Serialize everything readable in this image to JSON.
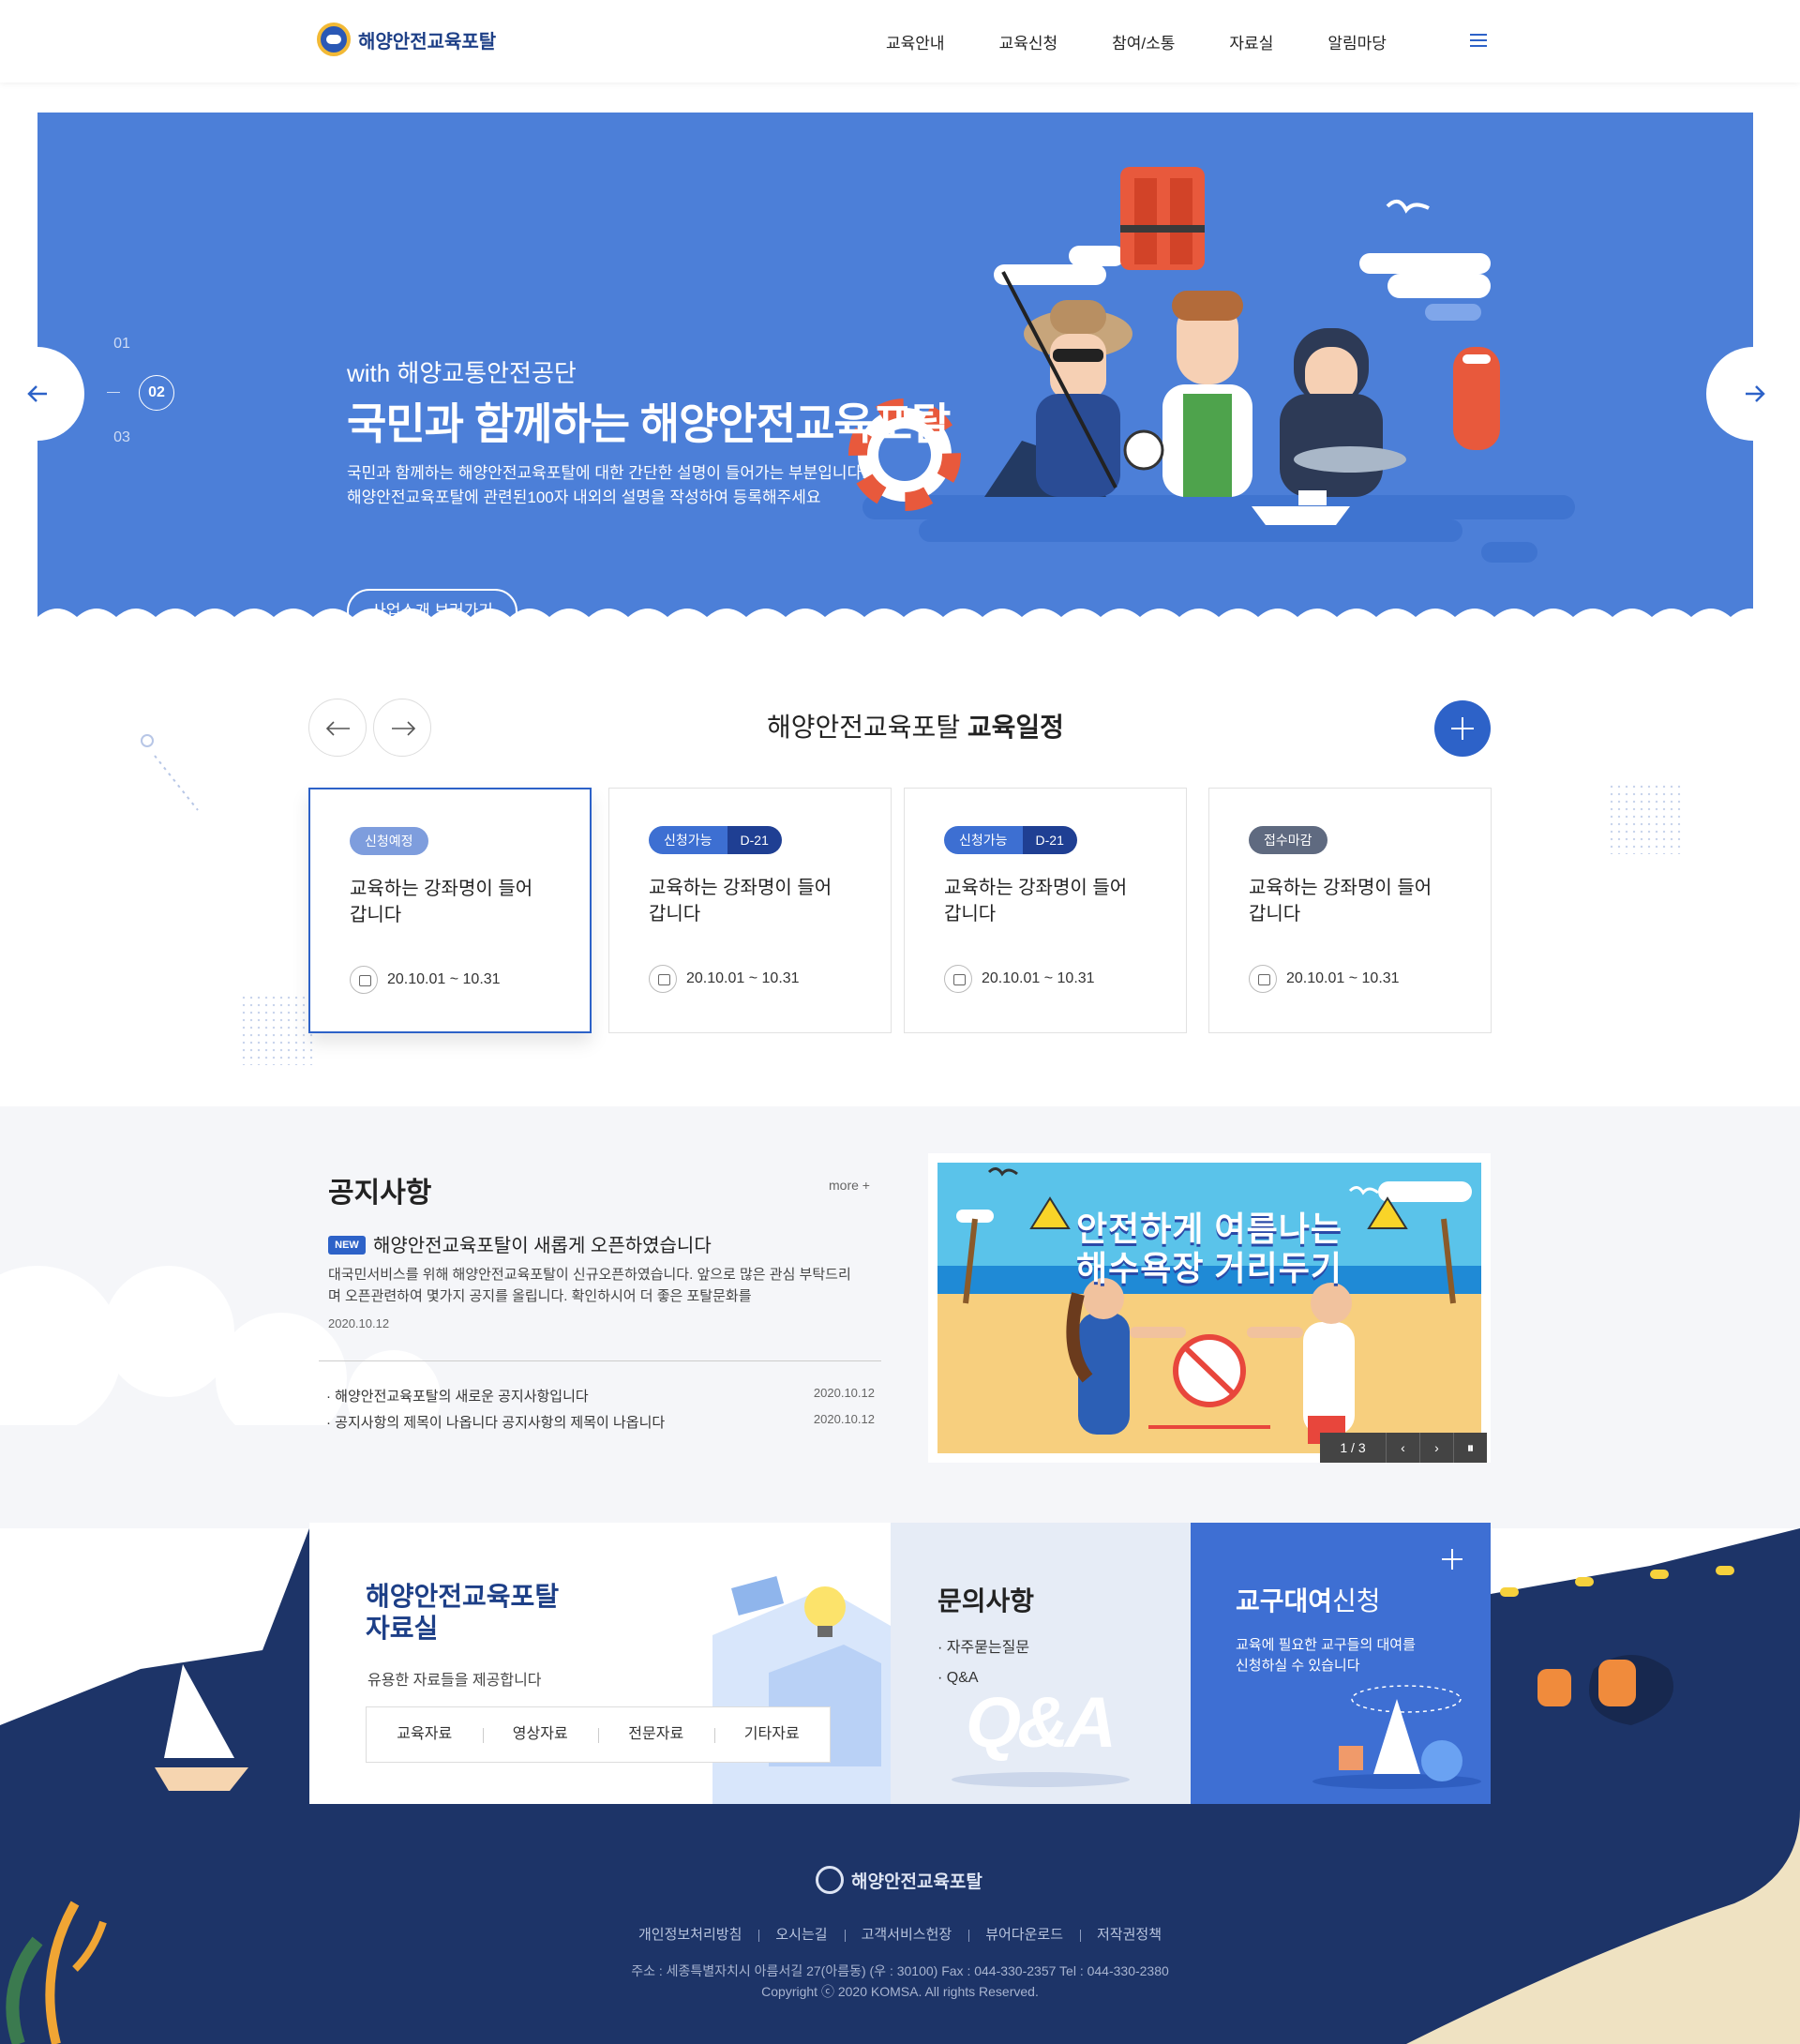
{
  "header": {
    "logo_text": "해양안전교육포탈",
    "nav": [
      "교육안내",
      "교육신청",
      "참여/소통",
      "자료실",
      "알림마당"
    ]
  },
  "hero": {
    "sub": "with 해양교통안전공단",
    "title": "국민과 함께하는 해양안전교육포탈",
    "desc1": "국민과 함께하는 해양안전교육포탈에 대한 간단한 설명이 들어가는 부분입니다.",
    "desc2": "해양안전교육포탈에 관련된100자 내외의 설명을 작성하여 등록해주세요",
    "button": "사업소개 보러가기",
    "pager": [
      "01",
      "02",
      "03"
    ]
  },
  "schedule": {
    "title_pre": "해양안전교육포탈",
    "title_bold": "교육일정",
    "cards": [
      {
        "status": "신청예정",
        "dday": "",
        "color": "#7e9ddd",
        "title": "교육하는 강좌명이 들어갑니다",
        "date": "20.10.01 ~ 10.31"
      },
      {
        "status": "신청가능",
        "dday": "D-21",
        "color": "#3d6fd2",
        "title": "교육하는 강좌명이 들어갑니다",
        "date": "20.10.01 ~ 10.31"
      },
      {
        "status": "신청가능",
        "dday": "D-21",
        "color": "#3d6fd2",
        "title": "교육하는 강좌명이 들어갑니다",
        "date": "20.10.01 ~ 10.31"
      },
      {
        "status": "접수마감",
        "dday": "",
        "color": "#5f6a80",
        "title": "교육하는 강좌명이 들어갑니다",
        "date": "20.10.01 ~ 10.31"
      }
    ]
  },
  "notice": {
    "title": "공지사항",
    "more": "more +",
    "new_tag": "NEW",
    "headline": "해양안전교육포탈이 새롭게 오픈하였습니다",
    "body": "대국민서비스를 위해 해양안전교육포탈이 신규오픈하였습니다. 앞으로 많은 관심 부탁드리며 오픈관련하여 몇가지 공지를 올립니다. 확인하시어 더 좋은 포탈문화를",
    "date": "2020.10.12",
    "items": [
      {
        "text": "· 해양안전교육포탈의 새로운 공지사항입니다",
        "date": "2020.10.12"
      },
      {
        "text": "· 공지사항의 제목이 나옵니다 공지사항의 제목이 나옵니다",
        "date": "2020.10.12"
      }
    ]
  },
  "banner": {
    "line1": "안전하게 여름나는",
    "line2": "해수욕장 거리두기",
    "page": "1 / 3"
  },
  "resources": {
    "title1": "해양안전교육포탈",
    "title2": "자료실",
    "sub": "유용한 자료들을 제공합니다",
    "tabs": [
      "교육자료",
      "영상자료",
      "전문자료",
      "기타자료"
    ]
  },
  "qna": {
    "title": "문의사항",
    "items": [
      "· 자주묻는질문",
      "· Q&A"
    ],
    "art": "Q&A"
  },
  "rental": {
    "title_a": "교구대여",
    "title_b": "신청",
    "desc": "교육에 필요한 교구들의 대여를 신청하실 수 있습니다"
  },
  "footer": {
    "logo_text": "해양안전교육포탈",
    "links": [
      "개인정보처리방침",
      "오시는길",
      "고객서비스헌장",
      "뷰어다운로드",
      "저작권정책"
    ],
    "address": "주소 : 세종특별자치시 아름서길 27(아름동) (우 : 30100)    Fax : 044-330-2357 Tel : 044-330-2380",
    "copyright": "Copyright ⓒ 2020 KOMSA. All rights Reserved."
  }
}
